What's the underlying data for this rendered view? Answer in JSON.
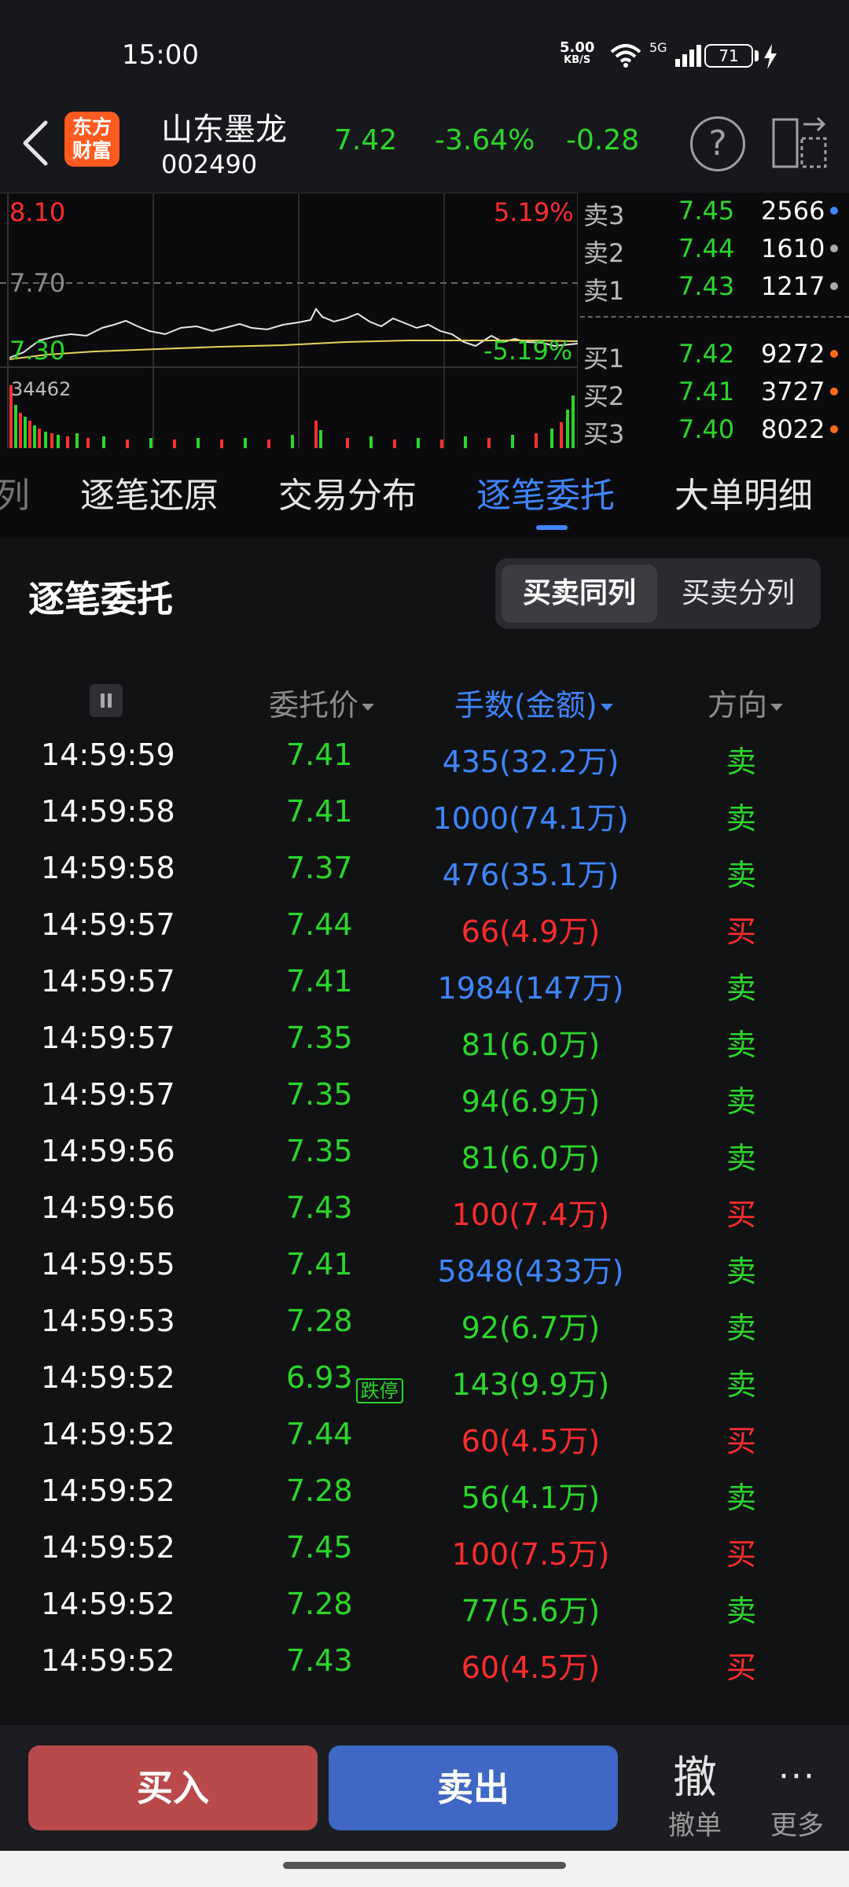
{
  "status_bar": {
    "time": "15:00",
    "speed_value": "5.00",
    "speed_unit": "KB/S",
    "network": "5G",
    "battery": "71"
  },
  "header": {
    "logo_line1": "东方",
    "logo_line2": "财富",
    "stock_name": "山东墨龙",
    "stock_code": "002490",
    "price": "7.42",
    "change_pct": "-3.64%",
    "change": "-0.28",
    "help_icon": "?"
  },
  "chart": {
    "high_price": "8.10",
    "high_pct": "5.19%",
    "mid_price": "7.70",
    "low_price": "7.30",
    "low_pct": "-5.19%",
    "max_volume": "34462"
  },
  "orderbook": {
    "asks": [
      {
        "label": "卖3",
        "price": "7.45",
        "volume": "2566",
        "dot": "#3e86ff"
      },
      {
        "label": "卖2",
        "price": "7.44",
        "volume": "1610",
        "dot": "#aaaaaa"
      },
      {
        "label": "卖1",
        "price": "7.43",
        "volume": "1217",
        "dot": "#aaaaaa"
      }
    ],
    "bids": [
      {
        "label": "买1",
        "price": "7.42",
        "volume": "9272",
        "dot": "#ff6a1a"
      },
      {
        "label": "买2",
        "price": "7.41",
        "volume": "3727",
        "dot": "#ff6a1a"
      },
      {
        "label": "买3",
        "price": "7.40",
        "volume": "8022",
        "dot": "#ff6a1a"
      }
    ]
  },
  "tabs": {
    "partial": "列",
    "items": [
      "逐笔还原",
      "交易分布",
      "逐笔委托",
      "大单明细"
    ],
    "active": "逐笔委托"
  },
  "section": {
    "title": "逐笔委托",
    "toggle_on": "买卖同列",
    "toggle_off": "买卖分列",
    "col_price": "委托价",
    "col_volume": "手数(金额)",
    "col_direction": "方向"
  },
  "orders": [
    {
      "time": "14:59:59",
      "price": "7.41",
      "price_color": "green",
      "volume": "435(32.2万)",
      "vol_color": "blue",
      "dir": "卖",
      "dir_color": "green"
    },
    {
      "time": "14:59:58",
      "price": "7.41",
      "price_color": "green",
      "volume": "1000(74.1万)",
      "vol_color": "blue",
      "dir": "卖",
      "dir_color": "green"
    },
    {
      "time": "14:59:58",
      "price": "7.37",
      "price_color": "green",
      "volume": "476(35.1万)",
      "vol_color": "blue",
      "dir": "卖",
      "dir_color": "green"
    },
    {
      "time": "14:59:57",
      "price": "7.44",
      "price_color": "green",
      "volume": "66(4.9万)",
      "vol_color": "red",
      "dir": "买",
      "dir_color": "red"
    },
    {
      "time": "14:59:57",
      "price": "7.41",
      "price_color": "green",
      "volume": "1984(147万)",
      "vol_color": "blue",
      "dir": "卖",
      "dir_color": "green"
    },
    {
      "time": "14:59:57",
      "price": "7.35",
      "price_color": "green",
      "volume": "81(6.0万)",
      "vol_color": "green",
      "dir": "卖",
      "dir_color": "green"
    },
    {
      "time": "14:59:57",
      "price": "7.35",
      "price_color": "green",
      "volume": "94(6.9万)",
      "vol_color": "green",
      "dir": "卖",
      "dir_color": "green"
    },
    {
      "time": "14:59:56",
      "price": "7.35",
      "price_color": "green",
      "volume": "81(6.0万)",
      "vol_color": "green",
      "dir": "卖",
      "dir_color": "green"
    },
    {
      "time": "14:59:56",
      "price": "7.43",
      "price_color": "green",
      "volume": "100(7.4万)",
      "vol_color": "red",
      "dir": "买",
      "dir_color": "red"
    },
    {
      "time": "14:59:55",
      "price": "7.41",
      "price_color": "green",
      "volume": "5848(433万)",
      "vol_color": "blue",
      "dir": "卖",
      "dir_color": "green"
    },
    {
      "time": "14:59:53",
      "price": "7.28",
      "price_color": "green",
      "volume": "92(6.7万)",
      "vol_color": "green",
      "dir": "卖",
      "dir_color": "green"
    },
    {
      "time": "14:59:52",
      "price": "6.93",
      "price_color": "green",
      "tag": "跌停",
      "volume": "143(9.9万)",
      "vol_color": "green",
      "dir": "卖",
      "dir_color": "green"
    },
    {
      "time": "14:59:52",
      "price": "7.44",
      "price_color": "green",
      "volume": "60(4.5万)",
      "vol_color": "red",
      "dir": "买",
      "dir_color": "red"
    },
    {
      "time": "14:59:52",
      "price": "7.28",
      "price_color": "green",
      "volume": "56(4.1万)",
      "vol_color": "green",
      "dir": "卖",
      "dir_color": "green"
    },
    {
      "time": "14:59:52",
      "price": "7.45",
      "price_color": "green",
      "volume": "100(7.5万)",
      "vol_color": "red",
      "dir": "买",
      "dir_color": "red"
    },
    {
      "time": "14:59:52",
      "price": "7.28",
      "price_color": "green",
      "volume": "77(5.6万)",
      "vol_color": "green",
      "dir": "卖",
      "dir_color": "green"
    },
    {
      "time": "14:59:52",
      "price": "7.43",
      "price_color": "green",
      "volume": "60(4.5万)",
      "vol_color": "red",
      "dir": "买",
      "dir_color": "red"
    }
  ],
  "bottom_bar": {
    "buy": "买入",
    "sell": "卖出",
    "cancel_icon": "撤",
    "cancel": "撤单",
    "more_icon": "···",
    "more": "更多"
  }
}
